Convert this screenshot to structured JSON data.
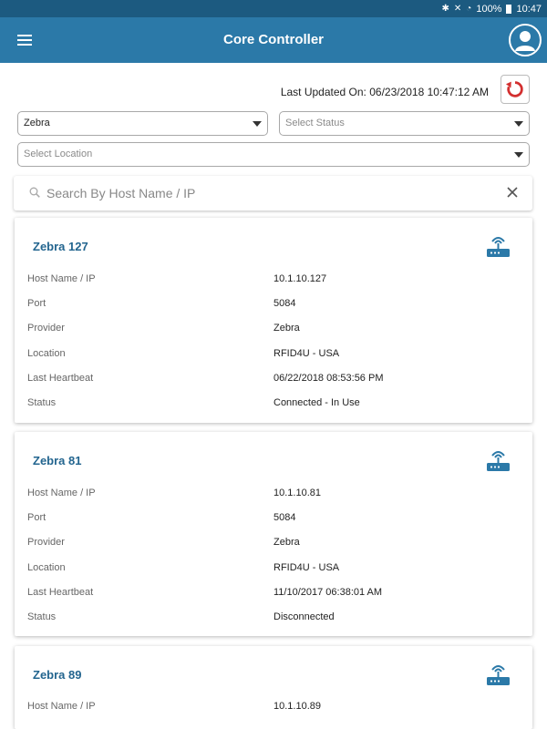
{
  "status_bar": {
    "icons": [
      "bluetooth-icon",
      "mute-icon",
      "wifi-icon",
      "battery-icon"
    ],
    "battery": "100%",
    "time": "10:47"
  },
  "app_bar": {
    "title": "Core Controller",
    "menu_icon": "hamburger-icon",
    "avatar_icon": "user-icon"
  },
  "toolbar": {
    "last_updated": "Last Updated On: 06/23/2018 10:47:12 AM",
    "refresh_icon": "refresh-icon",
    "refresh_color": "#d32f2f"
  },
  "filters": {
    "provider": {
      "value": "Zebra"
    },
    "status": {
      "placeholder": "Select Status"
    },
    "location": {
      "placeholder": "Select Location"
    }
  },
  "search": {
    "placeholder": "Search By Host Name / IP",
    "value": ""
  },
  "colors": {
    "header": "#2b79a8",
    "status_bar": "#1c5a80",
    "accent": "#23658f"
  },
  "labels": {
    "host": "Host Name / IP",
    "port": "Port",
    "provider": "Provider",
    "location": "Location",
    "heartbeat": "Last Heartbeat",
    "status": "Status"
  },
  "controllers": [
    {
      "name": "Zebra 127",
      "host": "10.1.10.127",
      "port": "5084",
      "provider": "Zebra",
      "location": "RFID4U  - USA",
      "heartbeat": "06/22/2018 08:53:56 PM",
      "status": "Connected - In Use"
    },
    {
      "name": "Zebra 81",
      "host": "10.1.10.81",
      "port": "5084",
      "provider": "Zebra",
      "location": "RFID4U  - USA",
      "heartbeat": "11/10/2017 06:38:01 AM",
      "status": "Disconnected"
    },
    {
      "name": "Zebra 89",
      "host": "10.1.10.89"
    }
  ]
}
